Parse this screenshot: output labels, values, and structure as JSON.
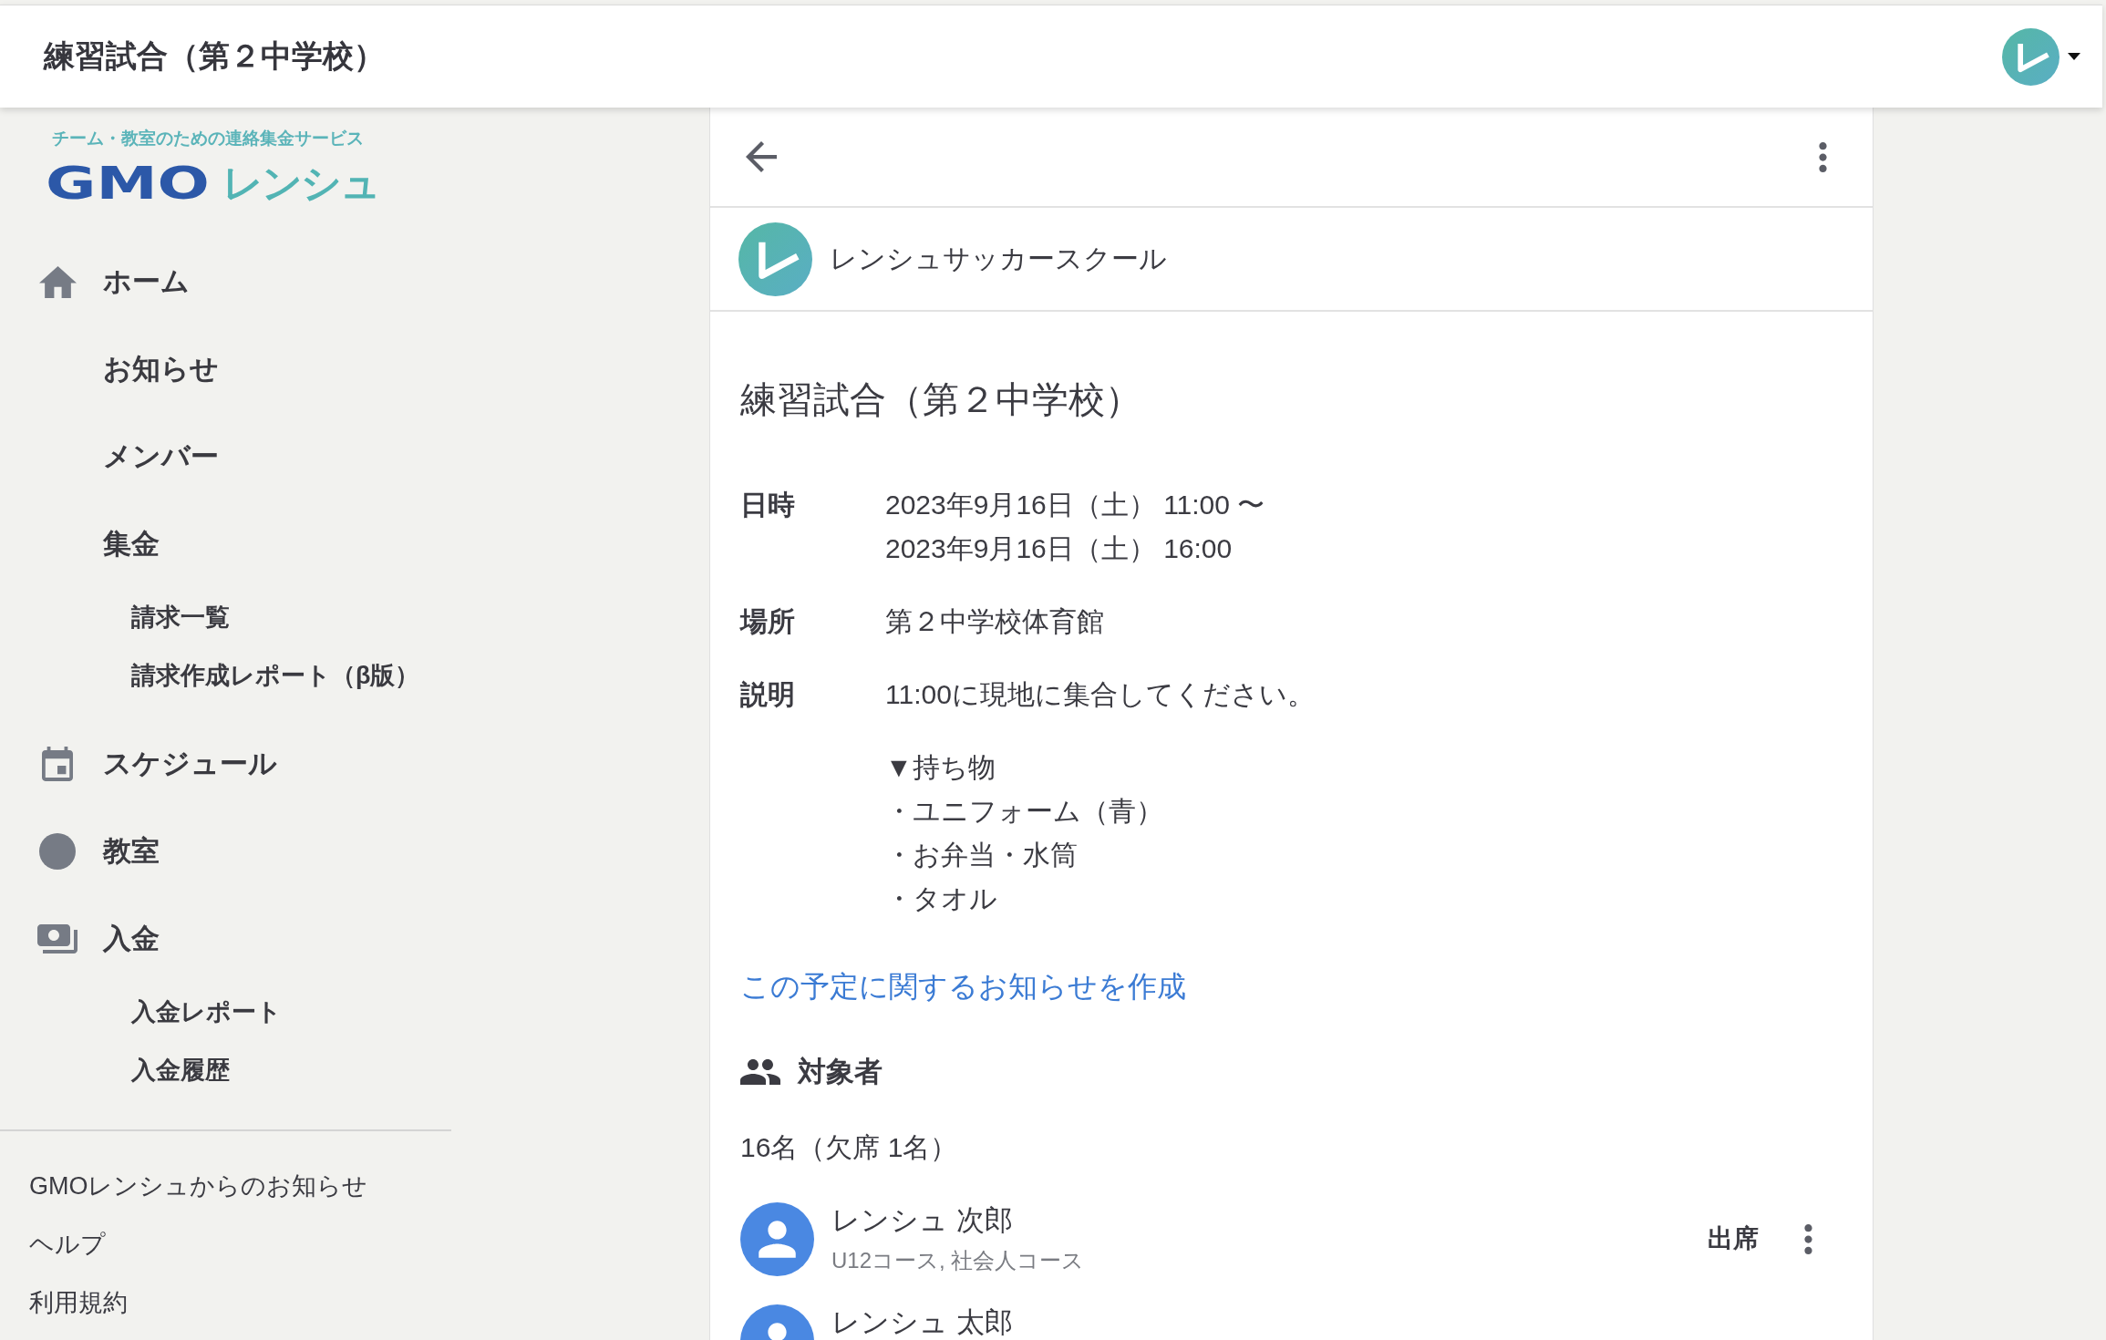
{
  "header": {
    "title": "練習試合（第２中学校）"
  },
  "sidebar": {
    "logo": {
      "tagline": "チーム・教室のための連絡集金サービス",
      "brand": "GMO",
      "product": "レンシュ"
    },
    "items": [
      {
        "label": "ホーム",
        "kind": "home",
        "selected": false
      },
      {
        "label": "お知らせ",
        "kind": "none",
        "selected": false
      },
      {
        "label": "メンバー",
        "kind": "none",
        "selected": false
      },
      {
        "label": "集金",
        "kind": "none",
        "selected": false,
        "children": [
          {
            "label": "請求一覧",
            "selected": false
          },
          {
            "label": "請求作成レポート（β版）",
            "selected": false
          }
        ]
      },
      {
        "label": "スケジュール",
        "kind": "calendar",
        "selected": false
      },
      {
        "label": "教室",
        "kind": "dot",
        "selected": false
      },
      {
        "label": "入金",
        "kind": "cash",
        "selected": false,
        "children": [
          {
            "label": "入金レポート",
            "selected": false
          },
          {
            "label": "入金履歴",
            "selected": false
          }
        ]
      }
    ],
    "footer_links": [
      "GMOレンシュからのお知らせ",
      "ヘルプ",
      "利用規約"
    ]
  },
  "event": {
    "organizer": "レンシュサッカースクール",
    "title": "練習試合（第２中学校）",
    "details": [
      {
        "label": "日時",
        "paragraphs": [
          [
            "2023年9月16日（土） 11:00 〜",
            "2023年9月16日（土） 16:00"
          ]
        ]
      },
      {
        "label": "場所",
        "paragraphs": [
          [
            "第２中学校体育館"
          ]
        ]
      },
      {
        "label": "説明",
        "paragraphs": [
          [
            "11:00に現地に集合してください。"
          ],
          [
            "▼持ち物",
            "・ユニフォーム（青）",
            "・お弁当・水筒",
            "・タオル"
          ]
        ]
      }
    ],
    "notice_link": "この予定に関するお知らせを作成",
    "attendees": {
      "heading": "対象者",
      "count": "16名（欠席 1名）",
      "members": [
        {
          "name": "レンシュ 次郎",
          "courses": "U12コース, 社会人コース",
          "status": "出席"
        },
        {
          "name": "レンシュ 太郎"
        }
      ]
    }
  }
}
